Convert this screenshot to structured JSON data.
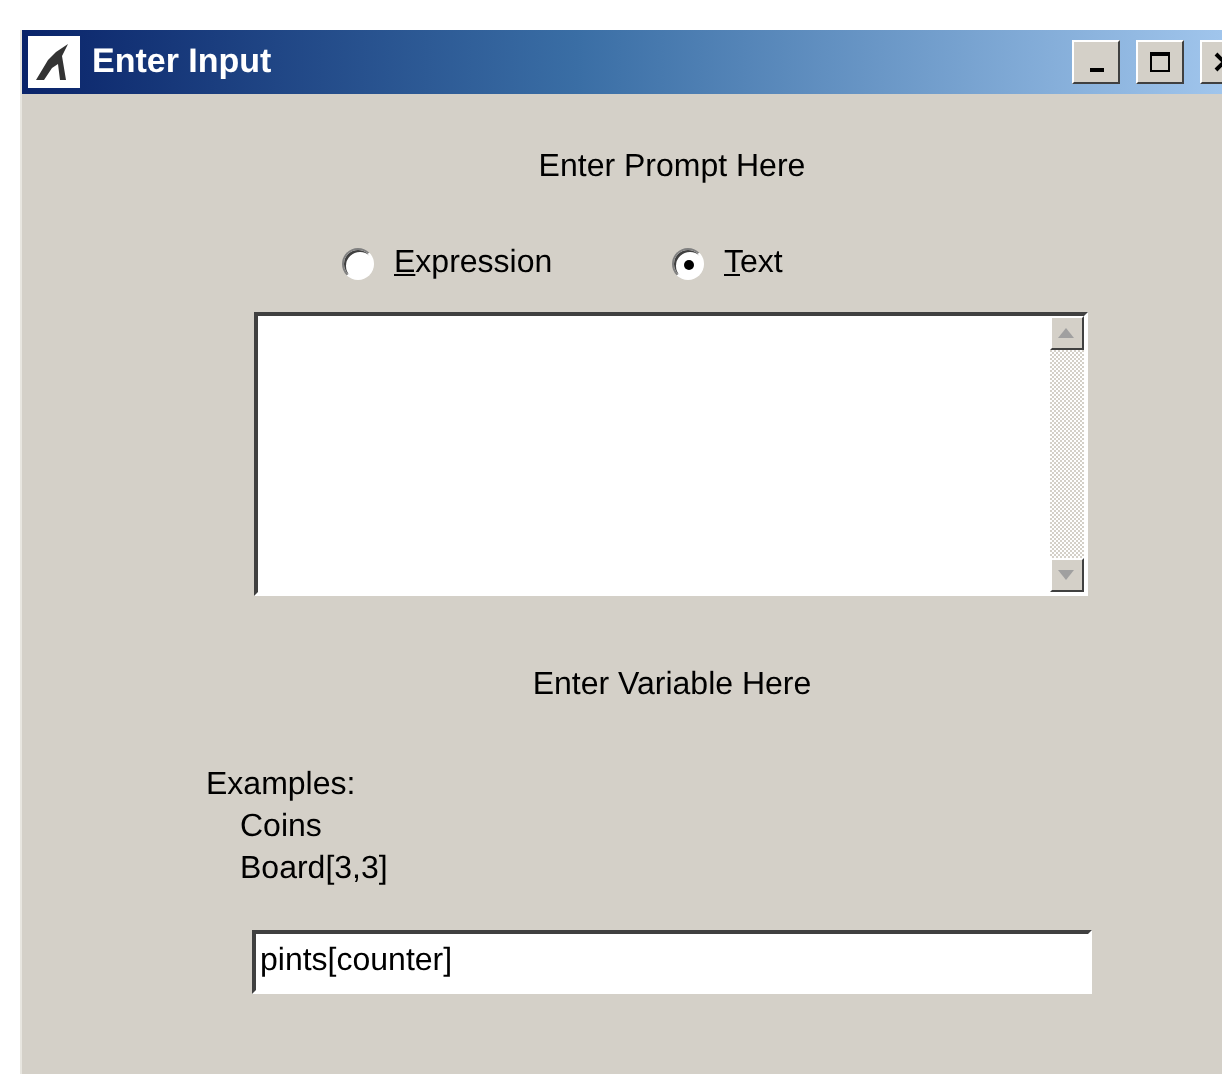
{
  "window": {
    "title": "Enter Input"
  },
  "prompt_label": "Enter Prompt Here",
  "modes": [
    {
      "mnemonic": "E",
      "rest": "xpression",
      "selected": false
    },
    {
      "mnemonic": "T",
      "rest": "ext",
      "selected": true
    }
  ],
  "variable_label": "Enter Variable Here",
  "examples": {
    "heading": "Examples:",
    "items": [
      "Coins",
      "Board[3,3]"
    ]
  },
  "variable_field": {
    "value": "pints[counter]"
  }
}
